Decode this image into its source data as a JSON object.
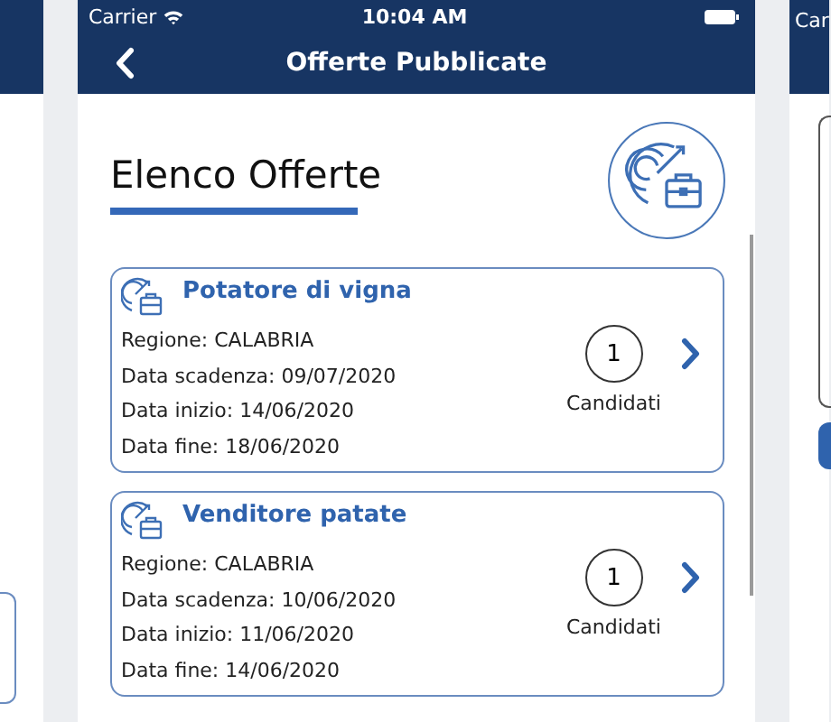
{
  "status_bar": {
    "carrier": "Carrier",
    "time": "10:04 AM"
  },
  "nav": {
    "title": "Offerte Pubblicate"
  },
  "heading": "Elenco Offerte",
  "offers": [
    {
      "title": "Potatore di vigna",
      "details": [
        "Regione: CALABRIA",
        "Data scadenza: 09/07/2020",
        "Data inizio: 14/06/2020",
        "Data fine: 18/06/2020"
      ],
      "count": "1",
      "count_label": "Candidati"
    },
    {
      "title": "Venditore patate",
      "details": [
        "Regione: CALABRIA",
        "Data scadenza: 10/06/2020",
        "Data inizio: 11/06/2020",
        "Data fine: 14/06/2020"
      ],
      "count": "1",
      "count_label": "Candidati"
    }
  ],
  "right_phone": {
    "carrier": "Car"
  }
}
